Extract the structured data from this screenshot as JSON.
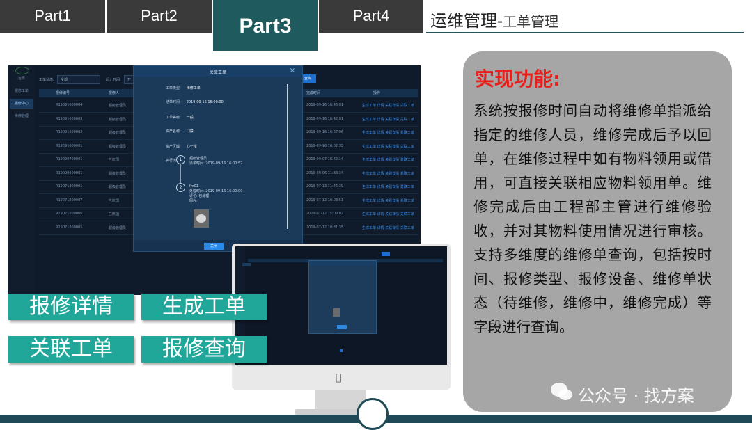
{
  "tabs": [
    {
      "label": "Part1"
    },
    {
      "label": "Part2"
    },
    {
      "label": "Part3",
      "active": true
    },
    {
      "label": "Part4"
    }
  ],
  "header": {
    "title_main": "运维管理-",
    "title_sub": "工单管理"
  },
  "screenshot": {
    "sidebar": [
      "首页",
      "报修工单",
      "报修中心",
      "维修管理"
    ],
    "filters": {
      "type_label": "工单状态:",
      "type_value": "全部",
      "time_label": "起止时间:",
      "time_value": "开",
      "query": "查询"
    },
    "columns": [
      "报修编号",
      "报修人",
      "完成时间",
      "操作"
    ],
    "rows": [
      {
        "id": "R19091600004",
        "person": "超级管理员",
        "time": "2019-09-16 16:46:01",
        "actions": "生成工单  详情  关联详情  关联工单"
      },
      {
        "id": "R19091600003",
        "person": "超级管理员",
        "time": "2019-09-16 16:42:01",
        "actions": "生成工单  详情  关联详情  关联工单"
      },
      {
        "id": "R19091600002",
        "person": "超级管理员",
        "time": "2019-09-16 16:27:06",
        "actions": "生成工单  详情  关联详情  关联工单"
      },
      {
        "id": "R19091600001",
        "person": "超级管理员",
        "time": "2019-09-16 16:02:35",
        "actions": "生成工单  详情  关联详情  关联工单"
      },
      {
        "id": "R19090700001",
        "person": "兰庆国",
        "time": "2019-09-07 16:42:14",
        "actions": "生成工单  详情  关联详情  关联工单"
      },
      {
        "id": "R19090600001",
        "person": "超级管理员",
        "time": "2019-09-06 11:33:34",
        "actions": "生成工单  详情  关联详情  关联工单"
      },
      {
        "id": "R19071300001",
        "person": "超级管理员",
        "time": "2019-07-13 11:46:39",
        "actions": "生成工单  详情  关联详情  关联工单"
      },
      {
        "id": "R19071200007",
        "person": "兰庆国",
        "time": "2019-07-12 16:03:51",
        "actions": "生成工单  详情  关联详情  关联工单"
      },
      {
        "id": "R19071200006",
        "person": "兰庆国",
        "time": "2019-07-12 15:09:02",
        "actions": "生成工单  详情  关联详情  关联工单"
      },
      {
        "id": "R19071200005",
        "person": "超级管理员",
        "time": "2019-07-12 10:31:35",
        "actions": "生成工单  详情  关联详情  关联工单"
      }
    ],
    "modal": {
      "title": "关联工单",
      "fields": [
        {
          "label": "工单类型:",
          "value": "维修工单"
        },
        {
          "label": "结单时间:",
          "value": "2019-09-16 16:00:00"
        },
        {
          "label": "工单等级:",
          "value": "一般"
        },
        {
          "label": "资产名称:",
          "value": "门禁"
        },
        {
          "label": "资产区域:",
          "value": "办一楼"
        },
        {
          "label": "执行流程:",
          "value": ""
        }
      ],
      "step1": {
        "num": "1",
        "name": "超级管理员",
        "detail": "派单时间: 2019-09-16 16:00:57"
      },
      "step2": {
        "num": "2",
        "name": "fm01",
        "detail1": "处理时间: 2019-09-16 16:00:00",
        "detail2": "评论: 已处理",
        "detail3": "图片:"
      },
      "close": "关闭"
    }
  },
  "features": [
    "报修详情",
    "生成工单",
    "关联工单",
    "报修查询"
  ],
  "panel": {
    "title": "实现功能:",
    "body": "系统按报修时间自动将维修单指派给指定的维修人员，维修完成后予以回单，在维修过程中如有物料领用或借用，可直接关联相应物料领用单。维修完成后由工程部主管进行维修验收，并对其物料使用情况进行审核。支持多维度的维修单查询，包括按时间、报修类型、报修设备、维修单状态（待维修，维修中，维修完成）等字段进行查询。"
  },
  "watermark": "公众号 · 找方案",
  "colors": {
    "tab_dark": "#3a3a3a",
    "tab_active": "#1e5a5e",
    "feature_teal": "#21a69a",
    "panel_gray": "#a6a6a6",
    "title_red": "#e8201b"
  }
}
